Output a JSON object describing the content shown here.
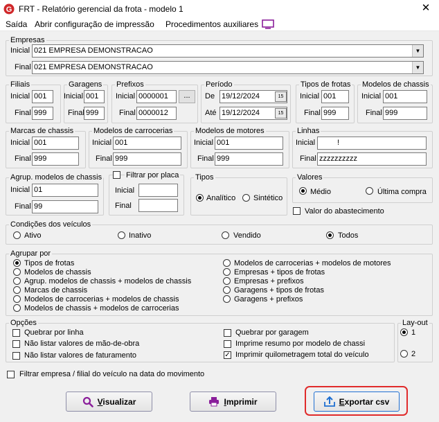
{
  "window": {
    "title": "FRT - Relatório gerencial da frota - modelo 1",
    "close_glyph": "✕"
  },
  "menu": {
    "items": [
      "Saída",
      "Abrir configuração de impressão",
      "Procedimentos auxiliares"
    ]
  },
  "empresas": {
    "legend": "Empresas",
    "inicial_label": "Inicial",
    "final_label": "Final",
    "inicial_value": "021 EMPRESA DEMONSTRACAO",
    "final_value": "021 EMPRESA DEMONSTRACAO"
  },
  "filiais": {
    "legend": "Filiais",
    "inicial_label": "Inicial",
    "final_label": "Final",
    "inicial": "001",
    "final": "999"
  },
  "garagens": {
    "legend": "Garagens",
    "inicial_label": "Inicial",
    "final_label": "Final",
    "inicial": "001",
    "final": "999"
  },
  "prefixos": {
    "legend": "Prefixos",
    "inicial_label": "Inicial",
    "final_label": "Final",
    "inicial": "0000001",
    "final": "0000012",
    "lookup_label": "..."
  },
  "periodo": {
    "legend": "Período",
    "de_label": "De",
    "ate_label": "Até",
    "de": "19/12/2024",
    "ate": "19/12/2024",
    "cal_label": "15"
  },
  "tipos_frotas": {
    "legend": "Tipos de frotas",
    "inicial_label": "Inicial",
    "final_label": "Final",
    "inicial": "001",
    "final": "999"
  },
  "modelos_chassis": {
    "legend": "Modelos de chassis",
    "inicial_label": "Inicial",
    "final_label": "Final",
    "inicial": "001",
    "final": "999"
  },
  "marcas_chassis": {
    "legend": "Marcas de chassis",
    "inicial_label": "Inicial",
    "final_label": "Final",
    "inicial": "001",
    "final": "999"
  },
  "modelos_carrocerias": {
    "legend": "Modelos de carrocerias",
    "inicial_label": "Inicial",
    "final_label": "Final",
    "inicial": "001",
    "final": "999"
  },
  "modelos_motores": {
    "legend": "Modelos de motores",
    "inicial_label": "Inicial",
    "final_label": "Final",
    "inicial": "001",
    "final": "999"
  },
  "linhas": {
    "legend": "Linhas",
    "inicial_label": "Inicial",
    "final_label": "Final",
    "inicial": "!",
    "final": "zzzzzzzzzz"
  },
  "agrup_modelos": {
    "legend": "Agrup. modelos de chassis",
    "inicial_label": "Inicial",
    "final_label": "Final",
    "inicial": "01",
    "final": "99"
  },
  "filtrar_placa": {
    "legend": "Filtrar por placa",
    "inicial_label": "Inicial",
    "final_label": "Final",
    "inicial": "",
    "final": ""
  },
  "tipos": {
    "legend": "Tipos",
    "analitico": "Analítico",
    "sintetico": "Sintético",
    "selected": "Analítico"
  },
  "valores": {
    "legend": "Valores",
    "medio": "Médio",
    "ultima": "Última compra",
    "selected": "Médio"
  },
  "valor_abastecimento": {
    "label": "Valor do abastecimento",
    "checked": false
  },
  "condicoes": {
    "legend": "Condições dos veículos",
    "options": [
      "Ativo",
      "Inativo",
      "Vendido",
      "Todos"
    ],
    "selected": "Todos"
  },
  "agrupar": {
    "legend": "Agrupar por",
    "left": [
      "Tipos de frotas",
      "Modelos de chassis",
      "Agrup. modelos de chassis + modelos de  chassis",
      "Marcas de chassis",
      "Modelos de carrocerias + modelos de chassis",
      "Modelos de chassis + modelos de carrocerias"
    ],
    "right": [
      "Modelos de carrocerias + modelos de motores",
      "Empresas + tipos de frotas",
      "Empresas + prefixos",
      "Garagens + tipos de frotas",
      "Garagens + prefixos"
    ],
    "selected": "Tipos de frotas"
  },
  "opcoes": {
    "legend": "Opções",
    "quebrar_linha": "Quebrar por linha",
    "nao_mao_obra": "Não listar valores de mão-de-obra",
    "nao_faturamento": "Não listar valores de faturamento",
    "quebrar_garagem": "Quebrar por garagem",
    "resumo_chassi": "Imprime resumo por modelo de chassi",
    "quilometragem": "Imprimir quilometragem total do veículo",
    "check_glyph": "✓"
  },
  "layout": {
    "legend": "Lay-out",
    "opt1": "1",
    "opt2": "2",
    "selected": "1"
  },
  "filtrar_empresa": {
    "label": "Filtrar empresa / filial do veículo na data do movimento",
    "checked": false
  },
  "buttons": {
    "visualizar_key": "V",
    "visualizar_rest": "isualizar",
    "imprimir_key": "I",
    "imprimir_rest": "mprimir",
    "exportar_key": "E",
    "exportar_rest": "xportar csv"
  },
  "colors": {
    "highlight": "#e02b2b",
    "icon_blue": "#1f6fd1",
    "icon_purple": "#8a1e9a",
    "brand_red": "#d0282a"
  }
}
